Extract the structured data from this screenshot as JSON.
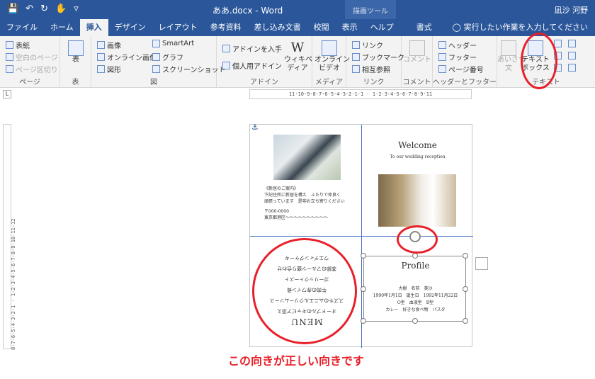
{
  "titlebar": {
    "document": "ああ.docx",
    "separator": " -  ",
    "app": "Word",
    "context_tab": "描画ツール",
    "user": "凪沙 河野",
    "bg_color": "#2b579a"
  },
  "tabs": [
    "ファイル",
    "ホーム",
    "挿入",
    "デザイン",
    "レイアウト",
    "参考資料",
    "差し込み文書",
    "校閲",
    "表示",
    "ヘルプ",
    "書式"
  ],
  "active_tab": "挿入",
  "tellme": "実行したい作業を入力してください",
  "ribbon": {
    "pages": {
      "label": "ページ",
      "items": [
        "表紙",
        "空白のページ",
        "ページ区切り"
      ]
    },
    "table": {
      "label": "表",
      "button": "表"
    },
    "illustrations": {
      "label": "図",
      "items": [
        "画像",
        "オンライン画像",
        "図形",
        "SmartArt",
        "グラフ",
        "スクリーンショット"
      ]
    },
    "addins": {
      "label": "アドイン",
      "items": [
        "アドインを入手",
        "個人用アドイン"
      ],
      "wiki_line1": "ウィキペ",
      "wiki_line2": "ディア"
    },
    "media": {
      "label": "メディア",
      "line1": "オンライン",
      "line2": "ビデオ"
    },
    "links": {
      "label": "リンク",
      "items": [
        "リンク",
        "ブックマーク",
        "相互参照"
      ]
    },
    "comment": {
      "label": "コメント",
      "button": "コメント"
    },
    "header_footer": {
      "label": "ヘッダーとフッター",
      "items": [
        "ヘッダー",
        "フッター",
        "ページ番号"
      ]
    },
    "text": {
      "label": "テキスト",
      "textbox_line1": "テキスト",
      "textbox_line2": "ボックス",
      "left_line1": "あいさつ",
      "left_line2": "文"
    }
  },
  "ruler": {
    "horizontal": "11·10·9·8·7·6·5·4·3·2·1·1 · 1·2·3·4·5·6·7·8·9·11",
    "vertical": "8·7·6·5·4·3·2·1 · 1·2·3·4·5·6·7·8·9·10·11·12"
  },
  "document": {
    "invite_lines": [
      "《新居のご案内》",
      "下記住所に新居を構え　ふたりで仲良く",
      "頑張っています　是非お立ち寄りください",
      "〒000-0000",
      "東京都港区〜〜〜〜〜〜〜〜〜〜"
    ],
    "welcome": "Welcome",
    "welcome_sub": "To our wedding reception",
    "menu_title": "MENU",
    "menu_lines": [
      "オードブルのキャビア添え",
      "スズキのムニエルクリームソース",
      "牛肉の赤ワイン煮",
      "ガーリックトースト",
      "季節のフルーツ盛り合わせ",
      "ウエディングケーキ"
    ],
    "profile_title": "Profile",
    "profile_lines": [
      "大樹　名前　美沙",
      "1990年1月1日　誕生日　1992年11月22日",
      "O型　血液型　B型",
      "カレー　好きな食べ物　パスタ"
    ]
  },
  "caption": "この向きが正しい向きです",
  "accent_red": "#e8202a"
}
